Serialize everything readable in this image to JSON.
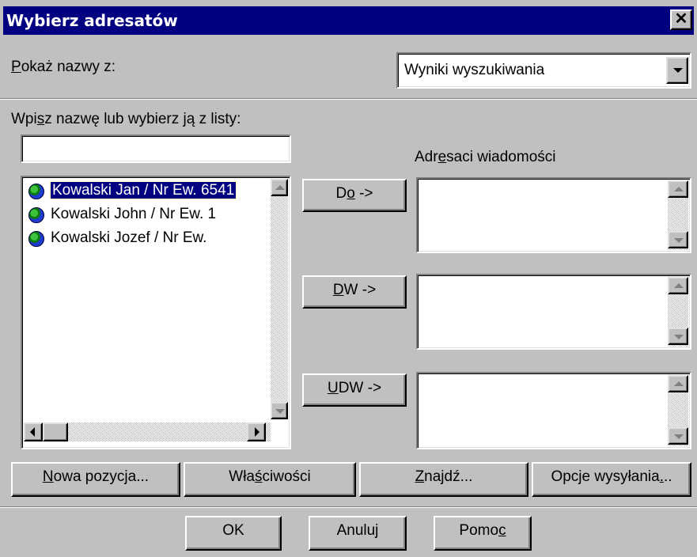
{
  "window": {
    "title": "Wybierz adresatów",
    "close_glyph": "✕"
  },
  "show_names": {
    "label": "Pokaż nazwy z:",
    "selected": "Wyniki wyszukiwania"
  },
  "search": {
    "label": "Wpisz nazwę lub wybierz ją z listy:",
    "value": ""
  },
  "recipients_label": "Adresaci wiadomości",
  "contacts": [
    {
      "label": "Kowalski Jan / Nr Ew. 6541",
      "icon": "globe-icon",
      "selected": true
    },
    {
      "label": "Kowalski John / Nr Ew. 1",
      "icon": "globe-icon",
      "selected": false
    },
    {
      "label": "Kowalski Jozef / Nr Ew.",
      "icon": "globe-icon",
      "selected": false
    }
  ],
  "fields": {
    "to": {
      "button": "Do ->"
    },
    "cc": {
      "button": "DW ->"
    },
    "bcc": {
      "button": "UDW ->"
    }
  },
  "actions": {
    "new_entry": "Nowa pozycja...",
    "properties": "Właściwości",
    "find": "Znajdź...",
    "send_options": "Opcje wysyłania..."
  },
  "footer": {
    "ok": "OK",
    "cancel": "Anuluj",
    "help": "Pomoc"
  },
  "colors": {
    "titlebar": "#000080",
    "face": "#c0c0c0",
    "selection": "#000080"
  }
}
